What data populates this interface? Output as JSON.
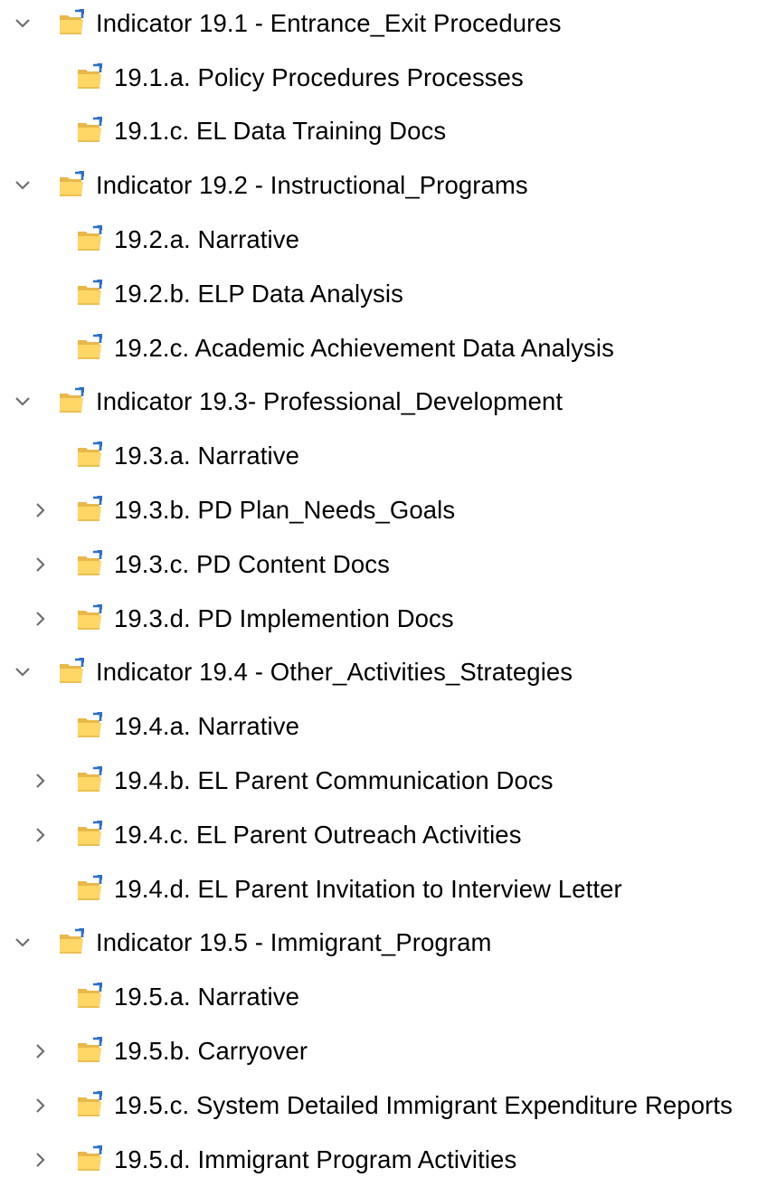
{
  "tree": {
    "items": [
      {
        "level": 0,
        "chevron": "chevron-down-icon",
        "icon": "folder-sync-icon",
        "label": "Indicator 19.1 - Entrance_Exit Procedures"
      },
      {
        "level": 1,
        "chevron": "none",
        "icon": "folder-sync-icon",
        "label": "19.1.a. Policy Procedures Processes"
      },
      {
        "level": 1,
        "chevron": "none",
        "icon": "folder-sync-icon",
        "label": "19.1.c. EL Data Training Docs"
      },
      {
        "level": 0,
        "chevron": "chevron-down-icon",
        "icon": "folder-sync-icon",
        "label": "Indicator 19.2 - Instructional_Programs"
      },
      {
        "level": 1,
        "chevron": "none",
        "icon": "folder-sync-icon",
        "label": "19.2.a. Narrative"
      },
      {
        "level": 1,
        "chevron": "none",
        "icon": "folder-sync-icon",
        "label": "19.2.b. ELP Data Analysis"
      },
      {
        "level": 1,
        "chevron": "none",
        "icon": "folder-sync-icon",
        "label": "19.2.c. Academic Achievement Data Analysis"
      },
      {
        "level": 0,
        "chevron": "chevron-down-icon",
        "icon": "folder-sync-icon",
        "label": "Indicator 19.3-  Professional_Development"
      },
      {
        "level": 1,
        "chevron": "none",
        "icon": "folder-sync-icon",
        "label": "19.3.a. Narrative"
      },
      {
        "level": 1,
        "chevron": "chevron-right-icon",
        "icon": "folder-sync-icon",
        "label": "19.3.b. PD Plan_Needs_Goals"
      },
      {
        "level": 1,
        "chevron": "chevron-right-icon",
        "icon": "folder-sync-icon",
        "label": "19.3.c. PD Content Docs"
      },
      {
        "level": 1,
        "chevron": "chevron-right-icon",
        "icon": "folder-sync-icon",
        "label": "19.3.d. PD Implemention Docs"
      },
      {
        "level": 0,
        "chevron": "chevron-down-icon",
        "icon": "folder-sync-icon",
        "label": "Indicator 19.4 - Other_Activities_Strategies"
      },
      {
        "level": 1,
        "chevron": "none",
        "icon": "folder-sync-icon",
        "label": "19.4.a. Narrative"
      },
      {
        "level": 1,
        "chevron": "chevron-right-icon",
        "icon": "folder-sync-icon",
        "label": "19.4.b. EL Parent Communication Docs"
      },
      {
        "level": 1,
        "chevron": "chevron-right-icon",
        "icon": "folder-sync-icon",
        "label": "19.4.c. EL Parent Outreach Activities"
      },
      {
        "level": 1,
        "chevron": "none",
        "icon": "folder-sync-icon",
        "label": "19.4.d. EL Parent Invitation to Interview Letter"
      },
      {
        "level": 0,
        "chevron": "chevron-down-icon",
        "icon": "folder-sync-icon",
        "label": "Indicator 19.5 - Immigrant_Program"
      },
      {
        "level": 1,
        "chevron": "none",
        "icon": "folder-sync-icon",
        "label": "19.5.a. Narrative"
      },
      {
        "level": 1,
        "chevron": "chevron-right-icon",
        "icon": "folder-sync-icon",
        "label": "19.5.b. Carryover"
      },
      {
        "level": 1,
        "chevron": "chevron-right-icon",
        "icon": "folder-sync-icon",
        "label": "19.5.c. System Detailed Immigrant Expenditure Reports"
      },
      {
        "level": 1,
        "chevron": "chevron-right-icon",
        "icon": "folder-sync-icon",
        "label": "19.5.d. Immigrant Program Activities"
      }
    ]
  },
  "colors": {
    "folder_back": "#e8b84a",
    "folder_front": "#ffd766",
    "folder_shadow": "#d9a93a",
    "sync_arrow": "#2e6fc9",
    "chevron": "#6e6e6e",
    "text": "#000000"
  }
}
